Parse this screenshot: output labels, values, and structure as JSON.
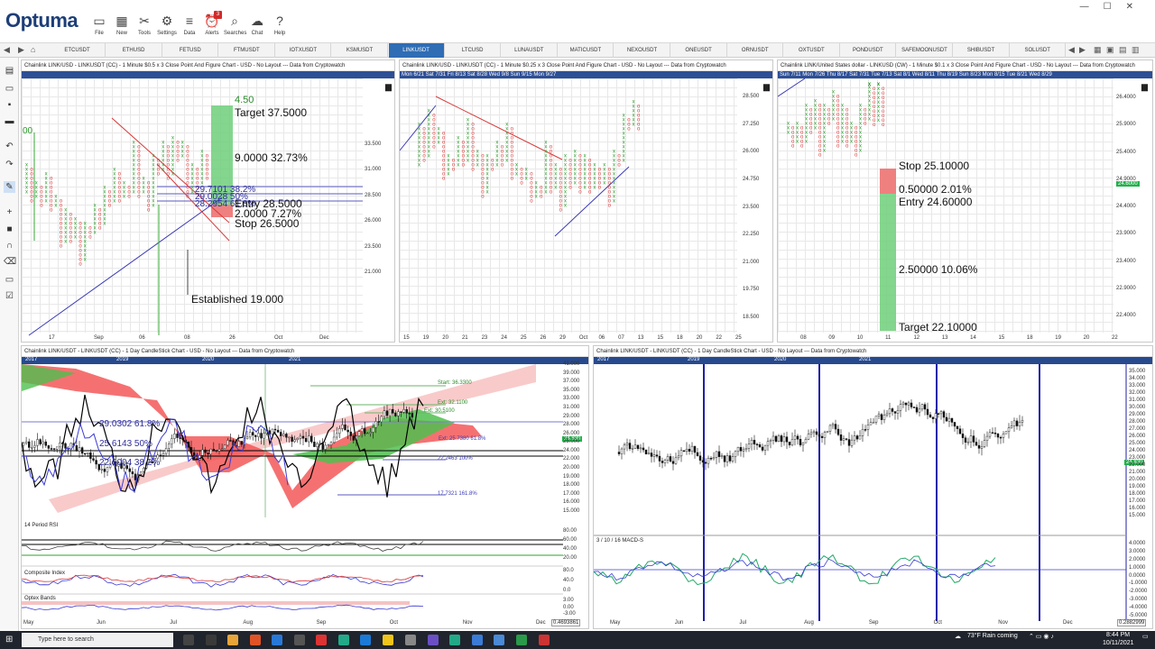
{
  "app": {
    "logo": "Optuma"
  },
  "ribbon": [
    {
      "name": "file-button",
      "icon": "folder-icon",
      "glyph": "▭",
      "label": "File"
    },
    {
      "name": "new-button",
      "icon": "grid-icon",
      "glyph": "▦",
      "label": "New"
    },
    {
      "name": "tools-button",
      "icon": "tools-icon",
      "glyph": "✂",
      "label": "Tools"
    },
    {
      "name": "settings-button",
      "icon": "gear-icon",
      "glyph": "⚙",
      "label": "Settings"
    },
    {
      "name": "data-button",
      "icon": "binary-icon",
      "glyph": "≡",
      "label": "Data"
    },
    {
      "name": "alerts-button",
      "icon": "alarm-icon",
      "glyph": "⏰",
      "label": "Alerts",
      "badge": "3"
    },
    {
      "name": "searches-button",
      "icon": "magnifier-icon",
      "glyph": "⌕",
      "label": "Searches"
    },
    {
      "name": "chat-button",
      "icon": "chat-icon",
      "glyph": "☁",
      "label": "Chat"
    },
    {
      "name": "help-button",
      "icon": "question-icon",
      "glyph": "?",
      "label": "Help"
    }
  ],
  "tabs": [
    "ETCUSDT",
    "ETHUSD",
    "FETUSD",
    "FTMUSDT",
    "IOTXUSDT",
    "KSMUSDT",
    "LINKUSDT",
    "LTCUSD",
    "LUNAUSDT",
    "MATICUSDT",
    "NEXOUSDT",
    "ONEUSDT",
    "ORNUSDT",
    "OXTUSDT",
    "PONDUSDT",
    "SAFEMOONUSDT",
    "SHIBUSDT",
    "SOLUSDT"
  ],
  "active_tab": "LINKUSDT",
  "panels": {
    "p1": {
      "title": "Chainlink LINK/USD - LINKUSDT (CC) - 1 Minute $0.5 x 3 Close Point And Figure Chart - USD - No Layout --- Data from Cryptowatch",
      "yaxis": [
        "33.500",
        "31.000",
        "28.500",
        "26.000",
        "23.500",
        "21.000"
      ],
      "xaxis": [
        "17",
        "Sep",
        "06",
        "08",
        "26",
        "Oct",
        "Dec"
      ],
      "left_label": "00",
      "annotations": {
        "t1": "4.50",
        "t2": "Target  37.5000",
        "t3": "9.0000   32.73%",
        "t4": "Entry   28.5000",
        "t5": "2.0000   7.27%",
        "t6": "Stop   26.5000",
        "t7": "Established 19.000",
        "f1": "29.7101  38.2%",
        "f2": "29.0028  50%",
        "f3": "28.2954  61.8%"
      }
    },
    "p2": {
      "title": "Chainlink LINK/USD - LINKUSDT (CC) - 1 Minute $0.25 x 3 Close Point And Figure Chart - USD - No Layout --- Data from Cryptowatch",
      "yaxis": [
        "28.500",
        "27.250",
        "26.000",
        "24.750",
        "23.500",
        "22.250",
        "21.000",
        "19.750",
        "18.500"
      ],
      "xaxis": [
        "15",
        "19",
        "20",
        "21",
        "23",
        "24",
        "25",
        "26",
        "29",
        "Oct",
        "06",
        "07",
        "13",
        "15",
        "18",
        "20",
        "22",
        "25"
      ],
      "topbar": "Mon 6/21  Sat 7/31  Fri 8/13  Sat 8/28  Wed 9/8  Sun 9/15  Mon 9/27"
    },
    "p3": {
      "title": "Chainlink LINK/United States dollar - LINKUSD (CW) - 1 Minute $0.1 x 3 Close Point And Figure Chart - USD - No Layout --- Data from Cryptowatch",
      "yaxis": [
        "26.4000",
        "25.9000",
        "25.4000",
        "24.9000",
        "24.4000",
        "23.9000",
        "23.4000",
        "22.9000",
        "22.4000"
      ],
      "price_tag": "24.6000",
      "xaxis": [
        "08",
        "09",
        "10",
        "11",
        "12",
        "13",
        "14",
        "15",
        "18",
        "19",
        "20",
        "22"
      ],
      "topbar": "Sun 7/11  Mon 7/26  Thu 8/17  Sat 7/31  Tue 7/13  Sat 8/1  Wed 8/11  Thu 8/19  Sun 8/23  Mon 8/15  Tue 8/21  Wed 8/29",
      "annotations": {
        "stop": "Stop   25.10000",
        "risk": "0.50000   2.01%",
        "entry": "Entry   24.60000",
        "reward": "2.50000   10.06%",
        "target": "Target   22.10000"
      }
    },
    "p4": {
      "title": "Chainlink LINK/USDT - LINKUSDT (CC) - 1 Day CandleStick Chart - USD - No Layout --- Data from Cryptowatch",
      "topyears": [
        "2017",
        "2019",
        "2020",
        "2021"
      ],
      "yaxis": [
        "41.000",
        "39.000",
        "37.000",
        "35.000",
        "33.000",
        "31.000",
        "29.000",
        "28.000",
        "26.000",
        "25.000",
        "24.000",
        "22.000",
        "20.000",
        "19.000",
        "18.000",
        "17.000",
        "16.000",
        "15.000"
      ],
      "price_tag": "24.830",
      "fib": {
        "a": "29.0302  61.8%",
        "b": "25.6143  50%",
        "c": "22.6004  38.2%"
      },
      "small": {
        "s1": "Start: 36.3300",
        "s2": "Ext: 32.1100",
        "s3": "Ext: 30.5100",
        "s4": "22.2463  100%",
        "s5": "17.7321  161.8%",
        "s6": "Ext: 25.7380  61.8%"
      },
      "rsi_label": "14 Period RSI",
      "rsi_axis": [
        "80.00",
        "60.00",
        "40.00",
        "20.00"
      ],
      "ci_label": "Composite Index",
      "ci_axis": [
        "80.0",
        "40.0",
        "0.0"
      ],
      "ob_label": "Optex Bands",
      "ob_axis": [
        "3.00",
        "0.00",
        "-3.00"
      ],
      "ob_tag": "0.4693861",
      "xaxis": [
        "May",
        "Jun",
        "Jul",
        "Aug",
        "Sep",
        "Oct",
        "Nov",
        "Dec"
      ]
    },
    "p5": {
      "title": "Chainlink LINK/USDT - LINKUSDT (CC) - 1 Day CandleStick Chart - USD - No Layout --- Data from Cryptowatch",
      "topyears": [
        "2017",
        "2019",
        "2020",
        "2021"
      ],
      "yaxis": [
        "35.000",
        "34.000",
        "33.000",
        "32.000",
        "31.000",
        "30.000",
        "29.000",
        "28.000",
        "27.000",
        "26.000",
        "25.000",
        "24.000",
        "23.000",
        "22.000",
        "21.000",
        "20.000",
        "19.000",
        "18.000",
        "17.000",
        "16.000",
        "15.000"
      ],
      "price_tag": "24.830",
      "macd_label": "3 / 10 / 16 MACD-S",
      "macd_axis": [
        "4.0000",
        "3.0000",
        "2.0000",
        "1.0000",
        "0.0000",
        "-1.0000",
        "-2.0000",
        "-3.0000",
        "-4.0000",
        "-5.0000"
      ],
      "macd_tag": "0.2882999",
      "xaxis": [
        "May",
        "Jun",
        "Jul",
        "Aug",
        "Sep",
        "Oct",
        "Nov",
        "Dec"
      ]
    }
  },
  "taskbar": {
    "search_placeholder": "Type here to search",
    "weather": "73°F  Rain coming",
    "time": "8:44 PM",
    "date": "10/11/2021"
  },
  "colors": {
    "accent": "#2f6db4",
    "red_zone": "#ef8080",
    "green_zone": "#6fcf7a",
    "cloud_red": "#f24e4e",
    "cloud_green": "#4fbf4f"
  }
}
